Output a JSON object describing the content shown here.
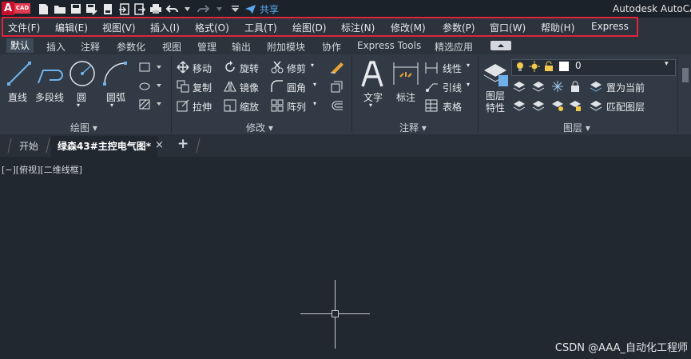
{
  "app": {
    "logo_main": "A",
    "logo_badge": "CAD",
    "title": "Autodesk AutoCAD",
    "share_label": "共享"
  },
  "quick_access": {
    "icons": [
      "new-icon",
      "open-icon",
      "save-icon",
      "save-as-icon",
      "publish-icon",
      "import-icon",
      "export-icon",
      "plot-icon",
      "undo-icon",
      "redo-icon",
      "customize-icon"
    ]
  },
  "menu": {
    "items": [
      "文件(F)",
      "编辑(E)",
      "视图(V)",
      "插入(I)",
      "格式(O)",
      "工具(T)",
      "绘图(D)",
      "标注(N)",
      "修改(M)",
      "参数(P)",
      "窗口(W)",
      "帮助(H)",
      "Express"
    ]
  },
  "ribbon_tabs": [
    "默认",
    "插入",
    "注释",
    "参数化",
    "视图",
    "管理",
    "输出",
    "附加模块",
    "协作",
    "Express Tools",
    "精选应用"
  ],
  "ribbon": {
    "draw": {
      "title": "绘图",
      "line": "直线",
      "polyline": "多段线",
      "circle": "圆",
      "arc": "圆弧"
    },
    "modify": {
      "title": "修改",
      "move": "移动",
      "rotate": "旋转",
      "trim": "修剪",
      "copy": "复制",
      "mirror": "镜像",
      "fillet": "圆角",
      "stretch": "拉伸",
      "scale": "缩放",
      "array": "阵列"
    },
    "annotation": {
      "title": "注释",
      "text": "文字",
      "dimension": "标注",
      "linear": "线性",
      "leader": "引线",
      "table": "表格"
    },
    "layers": {
      "title": "图层",
      "properties_line1": "图层",
      "properties_line2": "特性",
      "current_layer": "0",
      "set_current": "置为当前",
      "match_layer": "匹配图层"
    }
  },
  "doc_tabs": {
    "start": "开始",
    "active": "绿森43#主控电气图*",
    "close": "×",
    "add": "+"
  },
  "viewport": {
    "label": "[−][俯视][二维线框]"
  },
  "watermark": "CSDN @AAA_自动化工程师",
  "colors": {
    "background": "#212830",
    "ribbon": "#323b45",
    "highlight": "#e0243b",
    "accent": "#5aa8f0",
    "logo_red": "#c8102e"
  }
}
